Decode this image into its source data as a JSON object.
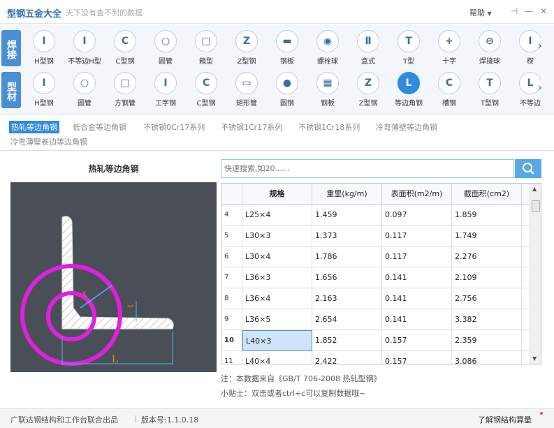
{
  "app": {
    "title": "型钢五金大全",
    "slogan": "天下没有查不到的数据",
    "help_label": "帮助",
    "help_arrow": "▼",
    "pin_symbol": "⊣",
    "minimize_symbol": "—",
    "close_symbol": "✕"
  },
  "categories": {
    "weld": {
      "label": "焊接",
      "items": [
        {
          "label": "H型钢",
          "glyph": "I"
        },
        {
          "label": "不等边H型",
          "glyph": "I"
        },
        {
          "label": "C型钢",
          "glyph": "C"
        },
        {
          "label": "圆管",
          "glyph": "○"
        },
        {
          "label": "箱型",
          "glyph": "□"
        },
        {
          "label": "Z型钢",
          "glyph": "Z"
        },
        {
          "label": "钢板",
          "glyph": "▬"
        },
        {
          "label": "螺栓球",
          "glyph": "◉"
        },
        {
          "label": "盒式",
          "glyph": "Ⅱ"
        },
        {
          "label": "T型",
          "glyph": "T"
        },
        {
          "label": "十字",
          "glyph": "+"
        },
        {
          "label": "焊接球",
          "glyph": "⊖"
        },
        {
          "label": "楔",
          "glyph": "I"
        }
      ]
    },
    "profile": {
      "label": "型材",
      "items": [
        {
          "label": "H型钢",
          "glyph": "I"
        },
        {
          "label": "圆管",
          "glyph": "○"
        },
        {
          "label": "方钢管",
          "glyph": "□"
        },
        {
          "label": "工字钢",
          "glyph": "I"
        },
        {
          "label": "C型钢",
          "glyph": "C"
        },
        {
          "label": "矩形管",
          "glyph": "▭"
        },
        {
          "label": "圆钢",
          "glyph": "●"
        },
        {
          "label": "钢板",
          "glyph": "▦"
        },
        {
          "label": "Z型钢",
          "glyph": "Z"
        },
        {
          "label": "等边角钢",
          "glyph": "L"
        },
        {
          "label": "槽钢",
          "glyph": "C"
        },
        {
          "label": "T型钢",
          "glyph": "T"
        },
        {
          "label": "不等边",
          "glyph": "L"
        }
      ]
    },
    "arrow": "›"
  },
  "subtypes": [
    "热轧等边角钢",
    "低合金等边角钢",
    "不锈钢0Cr17系列",
    "不锈钢1Cr17系列",
    "不锈钢1Cr18系列",
    "冷弯薄壁等边角钢",
    "冷弯薄壁卷边等边角钢"
  ],
  "drawing": {
    "title": "热轧等边角钢",
    "label_r": "r",
    "label_t": "t",
    "label_L": "L"
  },
  "search": {
    "placeholder": "快速搜索,如20......"
  },
  "table": {
    "headers": [
      "规格",
      "重里(kg/m)",
      "表面积(m2/m)",
      "截面积(cm2)"
    ],
    "rows": [
      {
        "idx": "4",
        "spec": "L25×4",
        "weight": "1.459",
        "surface": "0.097",
        "area": "1.859"
      },
      {
        "idx": "5",
        "spec": "L30×3",
        "weight": "1.373",
        "surface": "0.117",
        "area": "1.749"
      },
      {
        "idx": "6",
        "spec": "L30×4",
        "weight": "1.786",
        "surface": "0.117",
        "area": "2.276"
      },
      {
        "idx": "7",
        "spec": "L36×3",
        "weight": "1.656",
        "surface": "0.141",
        "area": "2.109"
      },
      {
        "idx": "8",
        "spec": "L36×4",
        "weight": "2.163",
        "surface": "0.141",
        "area": "2.756"
      },
      {
        "idx": "9",
        "spec": "L36×5",
        "weight": "2.654",
        "surface": "0.141",
        "area": "3.382"
      },
      {
        "idx": "10",
        "spec": "L40×3",
        "weight": "1.852",
        "surface": "0.157",
        "area": "2.359"
      },
      {
        "idx": "11",
        "spec": "L40×4",
        "weight": "2.422",
        "surface": "0.157",
        "area": "3.086"
      }
    ],
    "scroll_up": "▲",
    "scroll_down": "▼"
  },
  "notes": {
    "source": "注：本数据来自《GB/T  706-2008  热轧型钢》",
    "tip": "小贴士：双击或者ctrl+c可以复制数据哦~"
  },
  "status": {
    "publisher": "广联达钢结构和工作台联合出品",
    "version": "版本号:1.1.0.18",
    "learn_link": "了解钢结构算量"
  },
  "colors": {
    "accent": "#2e8be0",
    "drawing_bg": "#4a4f57",
    "circle": "#e020e0",
    "dimension": "#f08020"
  }
}
